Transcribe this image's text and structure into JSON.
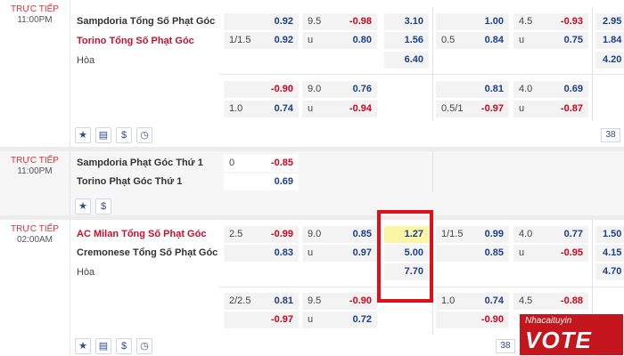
{
  "matches": [
    {
      "status": "TRỰC TIẾP",
      "time": "11:00PM",
      "home": "Sampdoria Tổng Số Phạt Góc",
      "away": "Torino Tổng Số Phạt Góc",
      "draw": "Hòa",
      "rows": [
        {
          "c1h": "",
          "c1v": "0.92",
          "c2h": "9.5",
          "c2v": "-0.98",
          "x1": "3.10",
          "c3h": "",
          "c3v": "1.00",
          "c4h": "4.5",
          "c4v": "-0.93",
          "x2": "2.95"
        },
        {
          "c1h": "1/1.5",
          "c1v": "0.92",
          "c2h": "u",
          "c2v": "0.80",
          "x1": "1.56",
          "c3h": "0.5",
          "c3v": "0.84",
          "c4h": "u",
          "c4v": "0.75",
          "x2": "1.84"
        },
        {
          "x1": "6.40",
          "x2": "4.20"
        },
        {
          "c1h": "",
          "c1v": "-0.90",
          "c2h": "9.0",
          "c2v": "0.76",
          "c3h": "",
          "c3v": "0.81",
          "c4h": "4.0",
          "c4v": "0.69"
        },
        {
          "c1h": "1.0",
          "c1v": "0.74",
          "c2h": "u",
          "c2v": "-0.94",
          "c3h": "0.5/1",
          "c3v": "-0.97",
          "c4h": "u",
          "c4v": "-0.87"
        }
      ],
      "count": "38"
    },
    {
      "status": "TRỰC TIẾP",
      "time": "11:00PM",
      "home": "Sampdoria Phạt Góc Thứ 1",
      "away": "Torino Phạt Góc Thứ 1",
      "rows": [
        {
          "c1h": "0",
          "c1v": "-0.85"
        },
        {
          "c1h": "",
          "c1v": "0.69"
        }
      ]
    },
    {
      "status": "TRỰC TIẾP",
      "time": "02:00AM",
      "home": "AC Milan Tổng Số Phạt Góc",
      "away": "Cremonese Tổng Số Phạt Góc",
      "draw": "Hòa",
      "rows": [
        {
          "c1h": "2.5",
          "c1v": "-0.99",
          "c2h": "9.0",
          "c2v": "0.85",
          "x1": "1.27",
          "c3h": "1/1.5",
          "c3v": "0.99",
          "c4h": "4.0",
          "c4v": "0.77",
          "x2": "1.50"
        },
        {
          "c1h": "",
          "c1v": "0.83",
          "c2h": "u",
          "c2v": "0.97",
          "x1": "5.00",
          "c3h": "",
          "c3v": "0.85",
          "c4h": "u",
          "c4v": "-0.95",
          "x2": "4.15"
        },
        {
          "x1": "7.70",
          "x2": "4.70"
        },
        {
          "c1h": "2/2.5",
          "c1v": "0.81",
          "c2h": "9.5",
          "c2v": "-0.90",
          "c3h": "1.0",
          "c3v": "0.74",
          "c4h": "4.5",
          "c4v": "-0.88"
        },
        {
          "c1h": "",
          "c1v": "-0.97",
          "c2h": "u",
          "c2v": "0.72",
          "c3h": "",
          "c3v": "-0.90",
          "c4h": "",
          "c4v": ""
        }
      ],
      "count": "38"
    }
  ],
  "logo": {
    "line1": "Nhacaituyin",
    "line2": "VOTE"
  },
  "colors": {
    "positive": "#1b3f8f",
    "negative": "#d0021b",
    "highlight": "#fbf6a6",
    "live": "#d8323a"
  }
}
